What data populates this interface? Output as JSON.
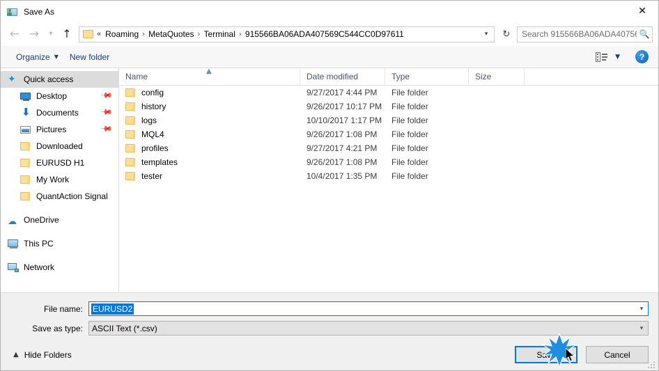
{
  "window": {
    "title": "Save As",
    "title_icon": "save-as-app-icon",
    "close_icon": "close-icon"
  },
  "navigation": {
    "back_icon": "arrow-left-icon",
    "forward_icon": "arrow-right-icon",
    "history_icon": "chevron-down-icon",
    "up_icon": "arrow-up-icon",
    "breadcrumb_overflow": "«",
    "breadcrumbs": [
      "Roaming",
      "MetaQuotes",
      "Terminal",
      "915566BA06ADA407569C544CC0D97611"
    ],
    "separator": "›",
    "address_caret_icon": "chevron-down-icon",
    "refresh_icon": "refresh-icon",
    "search_placeholder": "Search 915566BA06ADA40756...",
    "search_icon": "search-icon"
  },
  "commandbar": {
    "organize_label": "Organize",
    "organize_caret_icon": "caret-down-icon",
    "new_folder_label": "New folder",
    "view_icon": "view-layout-icon",
    "view_caret_icon": "caret-down-icon",
    "help_label": "?",
    "help_icon": "help-icon"
  },
  "sidebar": {
    "items": [
      {
        "label": "Quick access",
        "icon": "star-icon",
        "selected": true,
        "indent": false,
        "pinned": false
      },
      {
        "label": "Desktop",
        "icon": "monitor-icon",
        "selected": false,
        "indent": true,
        "pinned": true
      },
      {
        "label": "Documents",
        "icon": "download-arrow-icon",
        "selected": false,
        "indent": true,
        "pinned": true
      },
      {
        "label": "Pictures",
        "icon": "picture-icon",
        "selected": false,
        "indent": true,
        "pinned": true
      },
      {
        "label": "Downloaded",
        "icon": "folder-icon",
        "selected": false,
        "indent": true,
        "pinned": false
      },
      {
        "label": "EURUSD H1",
        "icon": "folder-icon",
        "selected": false,
        "indent": true,
        "pinned": false
      },
      {
        "label": "My Work",
        "icon": "folder-icon",
        "selected": false,
        "indent": true,
        "pinned": false
      },
      {
        "label": "QuantAction Signal",
        "icon": "folder-icon",
        "selected": false,
        "indent": true,
        "pinned": false
      },
      {
        "label": "OneDrive",
        "icon": "cloud-icon",
        "selected": false,
        "indent": false,
        "pinned": false
      },
      {
        "label": "This PC",
        "icon": "computer-icon",
        "selected": false,
        "indent": false,
        "pinned": false
      },
      {
        "label": "Network",
        "icon": "network-icon",
        "selected": false,
        "indent": false,
        "pinned": false
      }
    ],
    "pin_icon": "pin-icon"
  },
  "filelist": {
    "columns": [
      "Name",
      "Date modified",
      "Type",
      "Size"
    ],
    "sort_column": "Name",
    "sort_caret_icon": "sort-ascending-icon",
    "rows": [
      {
        "name": "config",
        "date": "9/27/2017 4:44 PM",
        "type": "File folder",
        "size": "",
        "icon": "folder-icon"
      },
      {
        "name": "history",
        "date": "9/26/2017 10:17 PM",
        "type": "File folder",
        "size": "",
        "icon": "folder-icon"
      },
      {
        "name": "logs",
        "date": "10/10/2017 1:17 PM",
        "type": "File folder",
        "size": "",
        "icon": "folder-icon"
      },
      {
        "name": "MQL4",
        "date": "9/26/2017 1:08 PM",
        "type": "File folder",
        "size": "",
        "icon": "folder-icon"
      },
      {
        "name": "profiles",
        "date": "9/27/2017 4:21 PM",
        "type": "File folder",
        "size": "",
        "icon": "folder-icon"
      },
      {
        "name": "templates",
        "date": "9/26/2017 1:08 PM",
        "type": "File folder",
        "size": "",
        "icon": "folder-icon"
      },
      {
        "name": "tester",
        "date": "10/4/2017 1:35 PM",
        "type": "File folder",
        "size": "",
        "icon": "folder-icon"
      }
    ]
  },
  "form": {
    "filename_label": "File name:",
    "filename_value": "EURUSD2",
    "filename_caret_icon": "chevron-down-icon",
    "filetype_label": "Save as type:",
    "filetype_value": "ASCII Text (*.csv)",
    "filetype_caret_icon": "chevron-down-icon"
  },
  "actions": {
    "hide_folders_label": "Hide Folders",
    "hide_folders_caret_icon": "chevron-up-icon",
    "save_label": "Save",
    "cancel_label": "Cancel",
    "resize_grip_icon": "resize-grip-icon"
  },
  "colors": {
    "accent": "#0078d7",
    "folder": "#fcdf9b",
    "header_text": "#44546d",
    "command_text": "#1c3d6e",
    "selection": "#dcdcdc"
  }
}
